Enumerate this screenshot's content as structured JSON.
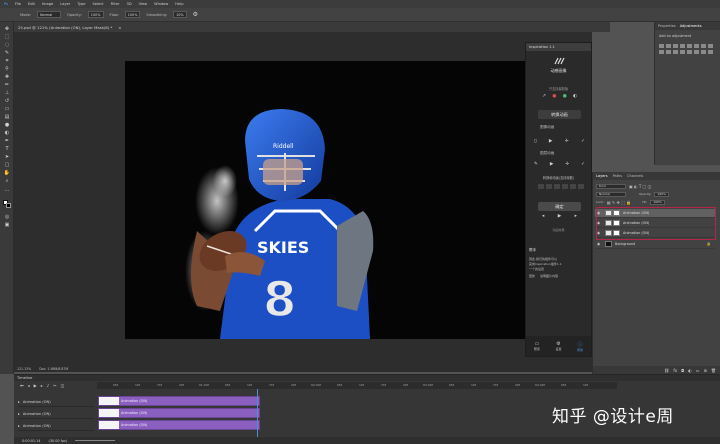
{
  "menu": [
    "Ps",
    "File",
    "Edit",
    "Image",
    "Layer",
    "Type",
    "Select",
    "Filter",
    "3D",
    "View",
    "Window",
    "Help"
  ],
  "options": {
    "mode_label": "Mode:",
    "mode_value": "Normal",
    "opacity_label": "Opacity:",
    "opacity_value": "100%",
    "flow_label": "Flow:",
    "flow_value": "100%",
    "smoothing_label": "Smoothing:",
    "smoothing_value": "10%"
  },
  "document_tab": "25.psd @ 121% (Animation (ON), Layer Mask/8) *",
  "plugin": {
    "title": "Inspiration 1.1",
    "brand": "动感画像",
    "sub": "只支持最新版",
    "btn_convert": "转换动画",
    "label_image_anim": "图像动画",
    "label_text_anim": "图层动画",
    "label_sequence": "转换帧动画(支持帧数)",
    "frame_label": "帧率",
    "btn_export": "确定",
    "footer_label": "动画效果",
    "help_title": "帮手",
    "help_text1": "因此,我们的插件可以",
    "help_text2": "完成Inspiration插件1.1",
    "help_text3": "一个的设置",
    "link1": "更新",
    "link2": "说明图片内容",
    "nav_preview": "预览",
    "nav_settings": "设置",
    "nav_help": "帮助"
  },
  "right_panel": {
    "tab1": "Properties",
    "tab2": "Adjustments",
    "add_label": "Add an adjustment"
  },
  "layers_panel": {
    "tab1": "Layers",
    "tab2": "Paths",
    "tab3": "Channels",
    "kind_label": "Kind",
    "blend": "Normal",
    "opacity_label": "Opacity:",
    "opacity_value": "100%",
    "lock_label": "Lock:",
    "fill_label": "Fill:",
    "fill_value": "100%",
    "layers": [
      {
        "name": "Animation (ON)",
        "selected": true
      },
      {
        "name": "Animation (ON)",
        "selected": false
      },
      {
        "name": "Animation (ON)",
        "selected": false
      },
      {
        "name": "Background",
        "selected": false
      }
    ]
  },
  "status": {
    "zoom": "121.13%",
    "doc": "Doc: 1.98M/8.87M"
  },
  "timeline": {
    "title": "Timeline",
    "ticks": [
      "05f",
      "10f",
      "15f",
      "20f",
      "01:00f",
      "05f",
      "10f",
      "15f",
      "20f",
      "02:00f",
      "05f",
      "10f",
      "15f",
      "20f",
      "03:00f",
      "05f",
      "10f",
      "15f",
      "20f",
      "04:00f",
      "05f",
      "10f"
    ],
    "tracks": [
      "Animation (ON)",
      "Animation (ON)",
      "Animation (ON)"
    ],
    "clips": [
      "Animation (ON)",
      "Animation (ON)",
      "Animation (ON)"
    ],
    "timecode": "0:00:01:14",
    "fps": "(30.00 fps)"
  },
  "jersey": {
    "team": "SKIES",
    "number": "8",
    "helmet_text": "Riddell"
  },
  "watermark": "知乎 @设计e周",
  "colors": {
    "jersey_blue": "#1d4fc4",
    "clip_purple": "#8b5fbf",
    "highlight_red": "#b2264a",
    "playhead_blue": "#4a90d9"
  }
}
